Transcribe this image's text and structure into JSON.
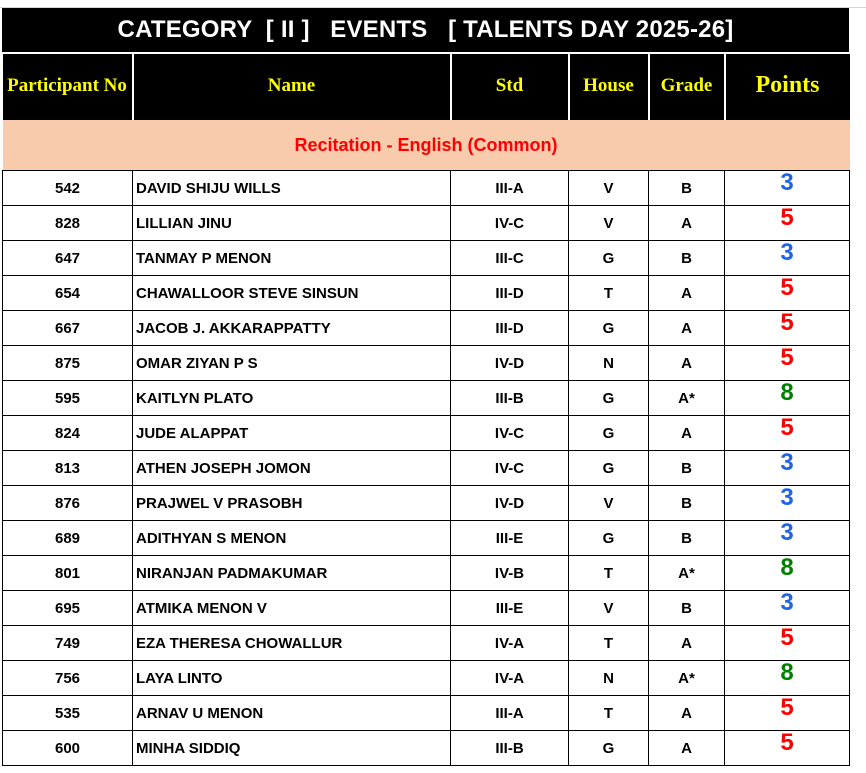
{
  "title": "CATEGORY  [ II ]   EVENTS   [ TALENTS DAY 2025-26]",
  "headers": {
    "participant_no": "Participant No",
    "name": "Name",
    "std": "Std",
    "house": "House",
    "grade": "Grade",
    "points": "Points"
  },
  "event": "Recitation - English (Common)",
  "colors": {
    "header_bg": "#000000",
    "header_text": "#ffff00",
    "event_bg": "#f8cbad",
    "event_text": "#ff0000",
    "points_3": "#1e64e6",
    "points_5": "#ff0000",
    "points_8": "#008000"
  },
  "rows": [
    {
      "no": "542",
      "name": "DAVID SHIJU WILLS",
      "std": "III-A",
      "house": "V",
      "grade": "B",
      "points": "3"
    },
    {
      "no": "828",
      "name": "LILLIAN JINU",
      "std": "IV-C",
      "house": "V",
      "grade": "A",
      "points": "5"
    },
    {
      "no": "647",
      "name": "TANMAY P MENON",
      "std": "III-C",
      "house": "G",
      "grade": "B",
      "points": "3"
    },
    {
      "no": "654",
      "name": "CHAWALLOOR STEVE SINSUN",
      "std": "III-D",
      "house": "T",
      "grade": "A",
      "points": "5"
    },
    {
      "no": "667",
      "name": "JACOB J. AKKARAPPATTY",
      "std": "III-D",
      "house": "G",
      "grade": "A",
      "points": "5"
    },
    {
      "no": "875",
      "name": "OMAR ZIYAN P S",
      "std": "IV-D",
      "house": "N",
      "grade": "A",
      "points": "5"
    },
    {
      "no": "595",
      "name": "KAITLYN PLATO",
      "std": "III-B",
      "house": "G",
      "grade": "A*",
      "points": "8"
    },
    {
      "no": "824",
      "name": "JUDE ALAPPAT",
      "std": "IV-C",
      "house": "G",
      "grade": "A",
      "points": "5"
    },
    {
      "no": "813",
      "name": "ATHEN JOSEPH JOMON",
      "std": "IV-C",
      "house": "G",
      "grade": "B",
      "points": "3"
    },
    {
      "no": "876",
      "name": "PRAJWEL V PRASOBH",
      "std": "IV-D",
      "house": "V",
      "grade": "B",
      "points": "3"
    },
    {
      "no": "689",
      "name": "ADITHYAN S MENON",
      "std": "III-E",
      "house": "G",
      "grade": "B",
      "points": "3"
    },
    {
      "no": "801",
      "name": "NIRANJAN PADMAKUMAR",
      "std": "IV-B",
      "house": "T",
      "grade": "A*",
      "points": "8"
    },
    {
      "no": "695",
      "name": "ATMIKA MENON V",
      "std": "III-E",
      "house": "V",
      "grade": "B",
      "points": "3"
    },
    {
      "no": "749",
      "name": "EZA THERESA CHOWALLUR",
      "std": "IV-A",
      "house": "T",
      "grade": "A",
      "points": "5"
    },
    {
      "no": "756",
      "name": "LAYA LINTO",
      "std": "IV-A",
      "house": "N",
      "grade": "A*",
      "points": "8"
    },
    {
      "no": "535",
      "name": "ARNAV U MENON",
      "std": "III-A",
      "house": "T",
      "grade": "A",
      "points": "5"
    },
    {
      "no": "600",
      "name": "MINHA SIDDIQ",
      "std": "III-B",
      "house": "G",
      "grade": "A",
      "points": "5"
    }
  ]
}
